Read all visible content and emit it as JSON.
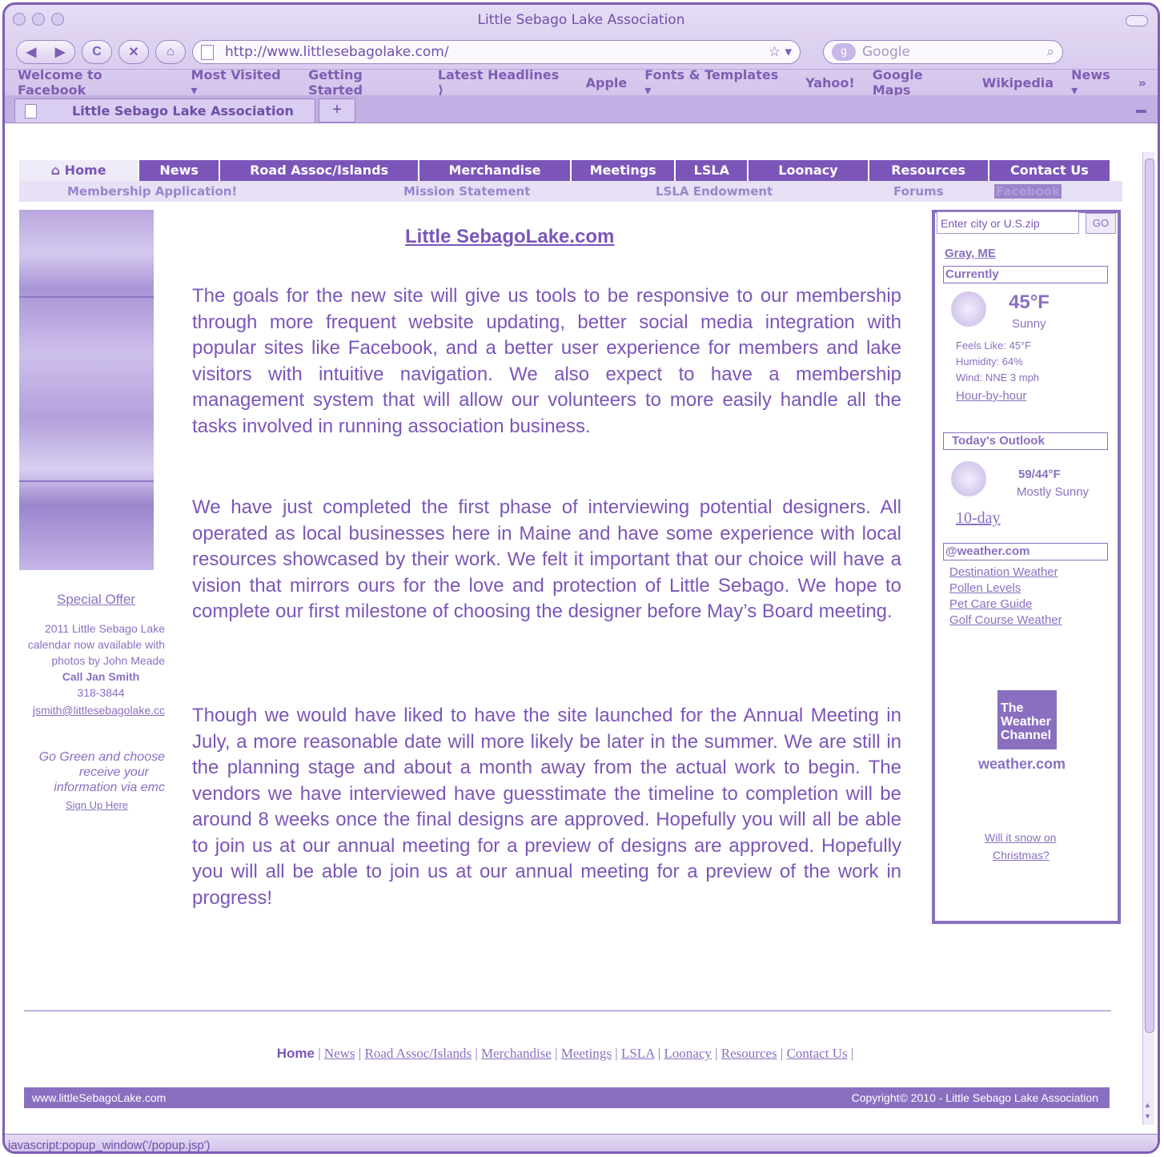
{
  "window": {
    "title": "Little Sebago Lake Association"
  },
  "toolbar": {
    "url": "http://www.littlesebagolake.com/",
    "search_placeholder": "Google"
  },
  "bookmarks": [
    "Welcome to Facebook",
    "Most Visited ▾",
    "Getting Started",
    "Latest Headlines ⟩",
    "Apple",
    "Fonts & Templates ▾",
    "Yahoo!",
    "Google Maps",
    "Wikipedia",
    "News ▾"
  ],
  "tab": {
    "label": "Little Sebago Lake Association"
  },
  "nav": {
    "main": [
      "Home",
      "News",
      "Road Assoc/Islands",
      "Merchandise",
      "Meetings",
      "LSLA",
      "Loonacy",
      "Resources",
      "Contact Us"
    ],
    "sub": [
      "Membership Application!",
      "Mission Statement",
      "LSLA Endowment",
      "Forums",
      "Facebook"
    ]
  },
  "left": {
    "special_offer": "Special Offer",
    "lines": [
      "2011 Little Sebago Lake",
      "calendar now available with",
      "photos by John Meade",
      "Call Jan Smith",
      "318-3844",
      "jsmith@littlesebagolake.cc"
    ],
    "go_green": [
      "Go Green and choose",
      "receive your",
      "information via emc"
    ],
    "signup": "Sign Up Here"
  },
  "main": {
    "headline": "Little SebagoLake.com",
    "paragraphs": [
      "The goals for the new site will give us tools to be responsive to our membership through more frequent website updating, better social media integration with popular sites like Facebook, and a better user experience for members and lake visitors with intuitive navigation. We also expect to have a membership management system that will allow our volunteers to more easily handle all the tasks involved in running association business.",
      "We have just completed the first phase of interviewing potential designers. All operated as local businesses here in Maine and have some experience with local resources showcased by their work. We felt it important that our choice will have a vision that mirrors ours for the love and protection of Little Sebago. We hope to complete our first milestone of choosing the designer before May’s Board meeting.",
      "Though we would have liked to have the site launched for the Annual Meeting in July, a more reasonable date will more likely be later in the summer. We are still in the planning stage and about a month away from the actual work to begin. The vendors we have interviewed have guesstimate the timeline to completion will be around 8 weeks once the final designs are approved. Hopefully you will all be able to join us at our annual meeting for a preview of designs are approved. Hopefully you will all be able to join us at our annual meeting for a preview of the work in progress!"
    ]
  },
  "weather": {
    "input_placeholder": "Enter city or U.S.zip",
    "go": "GO",
    "location": "Gray, ME",
    "currently": "Currently",
    "temp": "45°F",
    "condition": "Sunny",
    "feels_like": "Feels Like: 45°F",
    "humidity": "Humidity: 64%",
    "wind": "Wind: NNE 3 mph",
    "hourly": "Hour-by-hour",
    "outlook_title": "Today's Outlook",
    "outlook_temp": "59/44°F",
    "outlook_condition": "Mostly Sunny",
    "tenday": "10-day",
    "weathercom": "@weather.com",
    "links": [
      "Destination Weather",
      "Pollen Levels",
      "Pet Care Guide",
      "Golf Course Weather"
    ],
    "twc_logo": "The Weather Channel",
    "twc_url": "weather.com",
    "snow_line1": "Will it snow on",
    "snow_line2": "Christmas?"
  },
  "footer": {
    "home": "Home",
    "links": [
      "News",
      "Road Assoc/Islands",
      "Merchandise",
      "Meetings",
      "LSLA",
      "Loonacy",
      "Resources",
      "Contact Us"
    ],
    "site": "www.littleSebagoLake.com",
    "copyright": "Copyright© 2010 - Little Sebago Lake Association"
  },
  "status": "javascript:popup_window('/popup.jsp')"
}
